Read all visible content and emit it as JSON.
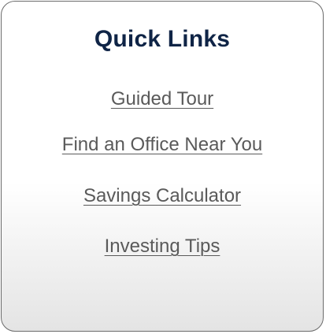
{
  "panel": {
    "title": "Quick Links",
    "links": [
      "Guided Tour",
      "Find an Office Near You",
      "Savings Calculator",
      "Investing Tips"
    ]
  }
}
